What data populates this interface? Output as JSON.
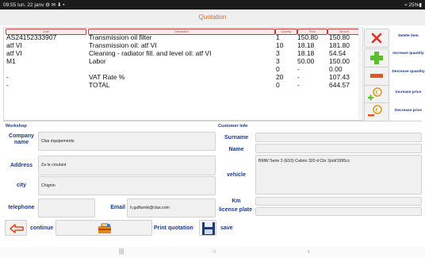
{
  "statusbar": {
    "left": "09:55  lun. 22 janv  ⚙ ✉ ⬇ •",
    "right": "≈ 25%▮"
  },
  "title": "Quotation",
  "table": {
    "headers": [
      "Code",
      "Description",
      "Quantity",
      "Price",
      "Amount"
    ],
    "rows": [
      [
        "AS24152333907",
        "Transmission oil filter",
        "1",
        "150.80",
        "150.80"
      ],
      [
        "atf VI",
        "Transmission oil: atf VI",
        "10",
        "18.18",
        "181.80"
      ],
      [
        "atf VI",
        "Cleaning - radiator fill. and level oil: atf VI",
        "3",
        "18.18",
        "54.54"
      ],
      [
        "M1",
        "Labor",
        "3",
        "50.00",
        "150.00"
      ],
      [
        "",
        "",
        "0",
        "-",
        "0.00"
      ],
      [
        "-",
        "VAT Rate %",
        "20",
        "-",
        "107.43"
      ],
      [
        "-",
        "TOTAL",
        "0",
        "-",
        "644.57"
      ]
    ]
  },
  "side_actions": [
    {
      "label": "Delete item",
      "icon": "delete-x-icon"
    },
    {
      "label": "Increase quantity",
      "icon": "plus-icon"
    },
    {
      "label": "Decrease quantity",
      "icon": "minus-icon"
    },
    {
      "label": "Increase price",
      "icon": "coin-plus-icon"
    },
    {
      "label": "Decrease price",
      "icon": "coin-minus-icon"
    }
  ],
  "workshop": {
    "section_title": "Workshop",
    "company_label": "Company name",
    "company_value": "Clas équipements",
    "address_label": "Address",
    "address_value": "Za la croulant",
    "city_label": "city",
    "city_value": "Chignin",
    "telephone_label": "telephone",
    "telephone_value": "",
    "email_label": "Email",
    "email_value": "h.gaffarnik@clas.com"
  },
  "customer": {
    "section_title": "Customer info",
    "surname_label": "Surname",
    "surname_value": "",
    "name_label": "Name",
    "name_value": "",
    "vehicle_label": "vehicle",
    "vehicle_value": "BMW Serie 3 (E93) Cabrio 320 d Cbr 2p/d/1995cc",
    "km_label": "Km",
    "km_value": "",
    "plate_label": "license plate",
    "plate_value": ""
  },
  "bottom": {
    "continue_label": "continue",
    "print_label": "Print quotation",
    "save_label": "save"
  },
  "colors": {
    "title": "#e06a1f",
    "label": "#1a3a8a",
    "header": "#c63a3a"
  }
}
